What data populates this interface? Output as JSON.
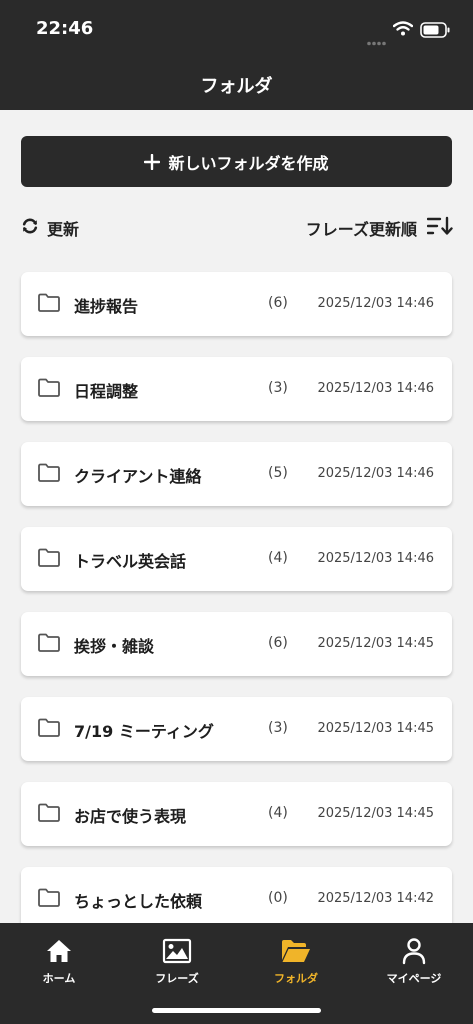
{
  "status_bar": {
    "time": "22:46"
  },
  "header": {
    "title": "フォルダ"
  },
  "new_folder_button": {
    "label": "新しいフォルダを作成"
  },
  "toolbar": {
    "refresh_label": "更新",
    "sort_label": "フレーズ更新順"
  },
  "folders": [
    {
      "name": "進捗報告",
      "count": "(6)",
      "updated": "2025/12/03 14:46"
    },
    {
      "name": "日程調整",
      "count": "(3)",
      "updated": "2025/12/03 14:46"
    },
    {
      "name": "クライアント連絡",
      "count": "(5)",
      "updated": "2025/12/03 14:46"
    },
    {
      "name": "トラベル英会話",
      "count": "(4)",
      "updated": "2025/12/03 14:46"
    },
    {
      "name": "挨拶・雑談",
      "count": "(6)",
      "updated": "2025/12/03 14:45"
    },
    {
      "name": "7/19 ミーティング",
      "count": "(3)",
      "updated": "2025/12/03 14:45"
    },
    {
      "name": "お店で使う表現",
      "count": "(4)",
      "updated": "2025/12/03 14:45"
    },
    {
      "name": "ちょっとした依頼",
      "count": "(0)",
      "updated": "2025/12/03 14:42"
    }
  ],
  "tab_bar": {
    "tabs": [
      {
        "label": "ホーム",
        "icon": "home-icon"
      },
      {
        "label": "フレーズ",
        "icon": "image-icon"
      },
      {
        "label": "フォルダ",
        "icon": "folder-open-icon",
        "active": true
      },
      {
        "label": "マイページ",
        "icon": "user-icon"
      }
    ]
  },
  "colors": {
    "dark": "#2a2a2a",
    "accent": "#f0b429",
    "background": "#f2f2f2"
  }
}
